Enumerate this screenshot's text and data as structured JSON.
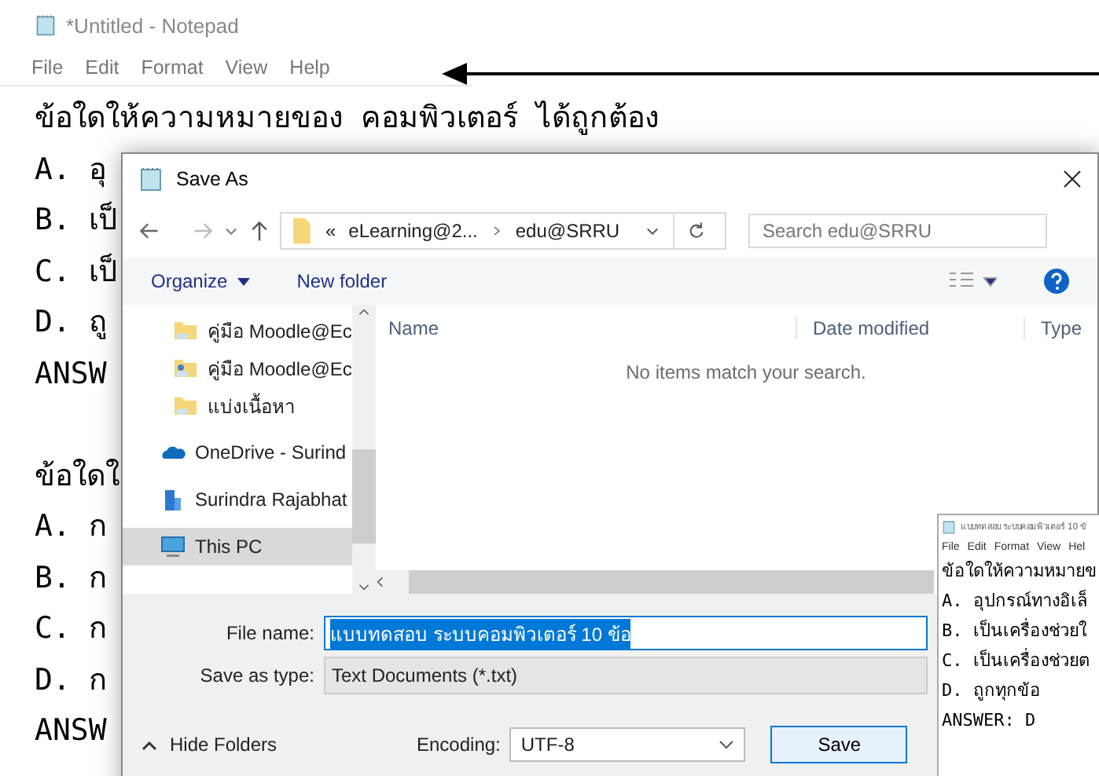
{
  "notepad": {
    "title": "*Untitled - Notepad",
    "menu": [
      "File",
      "Edit",
      "Format",
      "View",
      "Help"
    ],
    "questions": [
      {
        "lines": [
          "ข้อใดให้ความหมายของ คอมพิวเตอร์ ได้ถูกต้อง",
          "A. อุ",
          "B. เป็",
          "C. เป็",
          "D. ถู",
          "ANSW"
        ]
      },
      {
        "lines": [
          "ข้อใดใ",
          "A. ก",
          "B. ก",
          "C. ก",
          "D. ก",
          "ANSW"
        ]
      }
    ]
  },
  "dialog": {
    "title": "Save As",
    "address": {
      "overflow": "«",
      "crumbs": [
        "eLearning@2...",
        "edu@SRRU"
      ]
    },
    "search": {
      "placeholder": "Search edu@SRRU"
    },
    "toolbar": {
      "organize": "Organize",
      "new_folder": "New folder"
    },
    "nav_items": [
      {
        "label": "คู่มือ Moodle@Ec",
        "kind": "cloud-folder",
        "selected": false
      },
      {
        "label": "คู่มือ Moodle@Ec",
        "kind": "shared-folder",
        "selected": false
      },
      {
        "label": "แบ่งเนื้อหา",
        "kind": "cloud-folder",
        "selected": false
      },
      {
        "label": "OneDrive - Surind",
        "kind": "onedrive",
        "selected": false
      },
      {
        "label": "Surindra Rajabhat",
        "kind": "building",
        "selected": false
      },
      {
        "label": "This PC",
        "kind": "pc",
        "selected": true
      }
    ],
    "columns": [
      "Name",
      "Date modified",
      "Type"
    ],
    "empty_message": "No items match your search.",
    "file_name": {
      "label": "File name:",
      "value": "แบบทดสอบ ระบบคอมพิวเตอร์ 10 ข้อ"
    },
    "save_as_type": {
      "label": "Save as type:",
      "value": "Text Documents (*.txt)"
    },
    "hide_folders": "Hide Folders",
    "encoding": {
      "label": "Encoding:",
      "value": "UTF-8"
    },
    "buttons": [
      "Save"
    ]
  },
  "inset": {
    "title": "แบบทดสอบ ระบบคอมพิวเตอร์ 10 ข้",
    "menu": [
      "File",
      "Edit",
      "Format",
      "View",
      "Hel"
    ],
    "lines": [
      "ข้อใดให้ความหมายข",
      "A. อุปกรณ์ทางอิเล็",
      "B. เป็นเครื่องช่วยใ",
      "C. เป็นเครื่องช่วยต",
      "D. ถูกทุกข้อ",
      "ANSWER: D"
    ]
  }
}
